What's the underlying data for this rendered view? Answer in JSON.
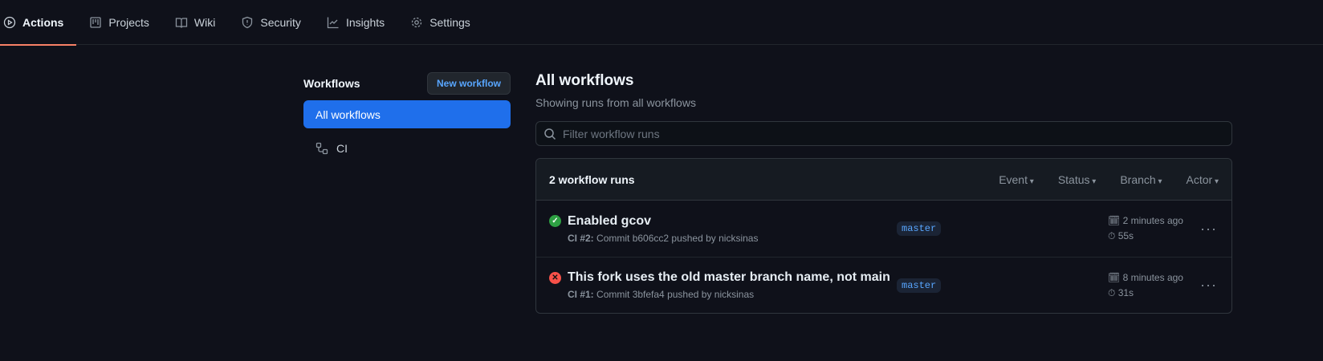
{
  "nav": {
    "tabs": [
      {
        "label": "Actions",
        "icon": "play-icon"
      },
      {
        "label": "Projects",
        "icon": "project-icon"
      },
      {
        "label": "Wiki",
        "icon": "book-icon"
      },
      {
        "label": "Security",
        "icon": "shield-icon"
      },
      {
        "label": "Insights",
        "icon": "graph-icon"
      },
      {
        "label": "Settings",
        "icon": "gear-icon"
      }
    ]
  },
  "sidebar": {
    "title": "Workflows",
    "new_button": "New workflow",
    "items": [
      {
        "label": "All workflows"
      },
      {
        "label": "CI"
      }
    ]
  },
  "main": {
    "title": "All workflows",
    "subtitle": "Showing runs from all workflows",
    "search_placeholder": "Filter workflow runs",
    "count": "2 workflow runs",
    "filters": [
      "Event",
      "Status",
      "Branch",
      "Actor"
    ],
    "runs": [
      {
        "status": "success",
        "title": "Enabled gcov",
        "workflow": "CI #2:",
        "meta": "Commit b606cc2 pushed by nicksinas",
        "branch": "master",
        "time": "2 minutes ago",
        "duration": "55s"
      },
      {
        "status": "failure",
        "title": "This fork uses the old master branch name, not main",
        "workflow": "CI #1:",
        "meta": "Commit 3bfefa4 pushed by nicksinas",
        "branch": "master",
        "time": "8 minutes ago",
        "duration": "31s"
      }
    ]
  },
  "colors": {
    "success": "#2ea043",
    "failure": "#f85149",
    "accent": "#1f6feb",
    "underline": "#f78166"
  }
}
